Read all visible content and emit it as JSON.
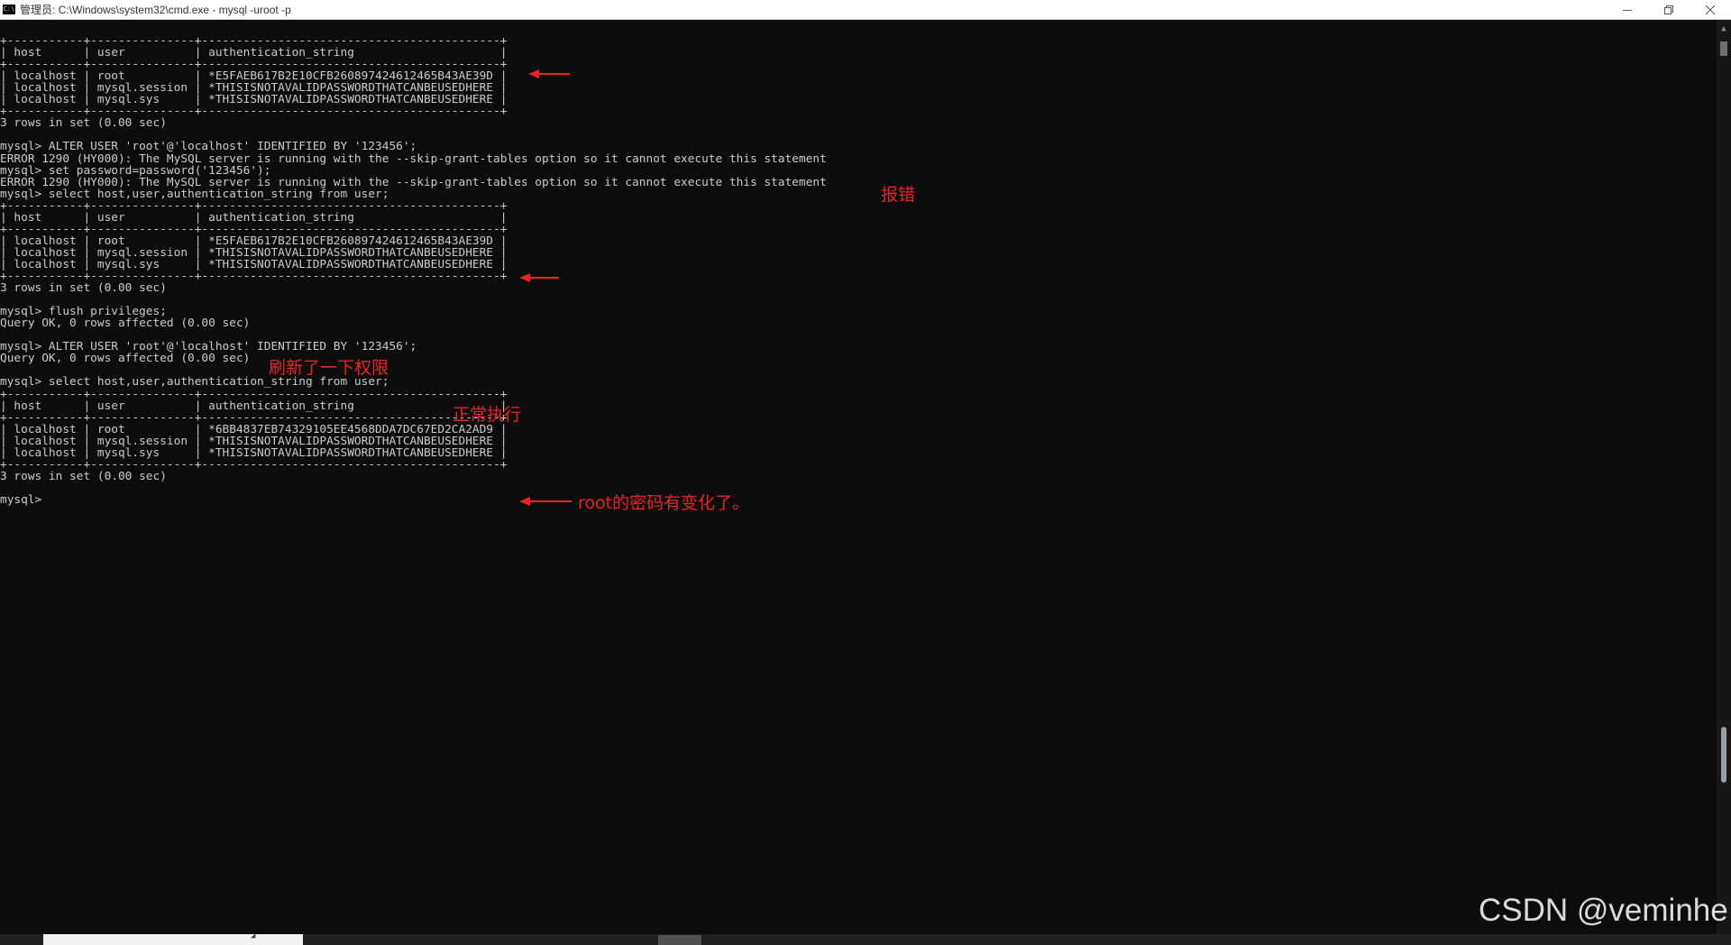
{
  "window": {
    "title": "管理员: C:\\Windows\\system32\\cmd.exe - mysql  -uroot -p",
    "app_icon": "C:\\",
    "controls": [
      "minimize-icon",
      "restore-icon",
      "close-icon"
    ]
  },
  "console_lines": [
    "+-----------+---------------+-------------------------------------------+",
    "| host      | user          | authentication_string                     |",
    "+-----------+---------------+-------------------------------------------+",
    "| localhost | root          | *E5FAEB617B2E10CFB260897424612465B43AE39D |",
    "| localhost | mysql.session | *THISISNOTAVALIDPASSWORDTHATCANBEUSEDHERE |",
    "| localhost | mysql.sys     | *THISISNOTAVALIDPASSWORDTHATCANBEUSEDHERE |",
    "+-----------+---------------+-------------------------------------------+",
    "3 rows in set (0.00 sec)",
    "",
    "mysql> ALTER USER 'root'@'localhost' IDENTIFIED BY '123456';",
    "ERROR 1290 (HY000): The MySQL server is running with the --skip-grant-tables option so it cannot execute this statement",
    "mysql> set password=password('123456');",
    "ERROR 1290 (HY000): The MySQL server is running with the --skip-grant-tables option so it cannot execute this statement",
    "mysql> select host,user,authentication_string from user;",
    "+-----------+---------------+-------------------------------------------+",
    "| host      | user          | authentication_string                     |",
    "+-----------+---------------+-------------------------------------------+",
    "| localhost | root          | *E5FAEB617B2E10CFB260897424612465B43AE39D |",
    "| localhost | mysql.session | *THISISNOTAVALIDPASSWORDTHATCANBEUSEDHERE |",
    "| localhost | mysql.sys     | *THISISNOTAVALIDPASSWORDTHATCANBEUSEDHERE |",
    "+-----------+---------------+-------------------------------------------+",
    "3 rows in set (0.00 sec)",
    "",
    "mysql> flush privileges;",
    "Query OK, 0 rows affected (0.00 sec)",
    "",
    "mysql> ALTER USER 'root'@'localhost' IDENTIFIED BY '123456';",
    "Query OK, 0 rows affected (0.00 sec)",
    "",
    "mysql> select host,user,authentication_string from user;",
    "+-----------+---------------+-------------------------------------------+",
    "| host      | user          | authentication_string                     |",
    "+-----------+---------------+-------------------------------------------+",
    "| localhost | root          | *6BB4837EB74329105EE4568DDA7DC67ED2CA2AD9 |",
    "| localhost | mysql.session | *THISISNOTAVALIDPASSWORDTHATCANBEUSEDHERE |",
    "| localhost | mysql.sys     | *THISISNOTAVALIDPASSWORDTHATCANBEUSEDHERE |",
    "+-----------+---------------+-------------------------------------------+",
    "3 rows in set (0.00 sec)",
    "",
    "mysql> "
  ],
  "annotations": {
    "error_note": "报错",
    "flush_note": "刷新了一下权限",
    "success_note": "正常执行",
    "changed_note": "root的密码有变化了。",
    "color": "#ee2222"
  },
  "watermark": "CSDN @veminhe",
  "colors": {
    "console_bg": "#0c0c0c",
    "console_text": "#cccccc",
    "annotation": "#ee2222"
  }
}
